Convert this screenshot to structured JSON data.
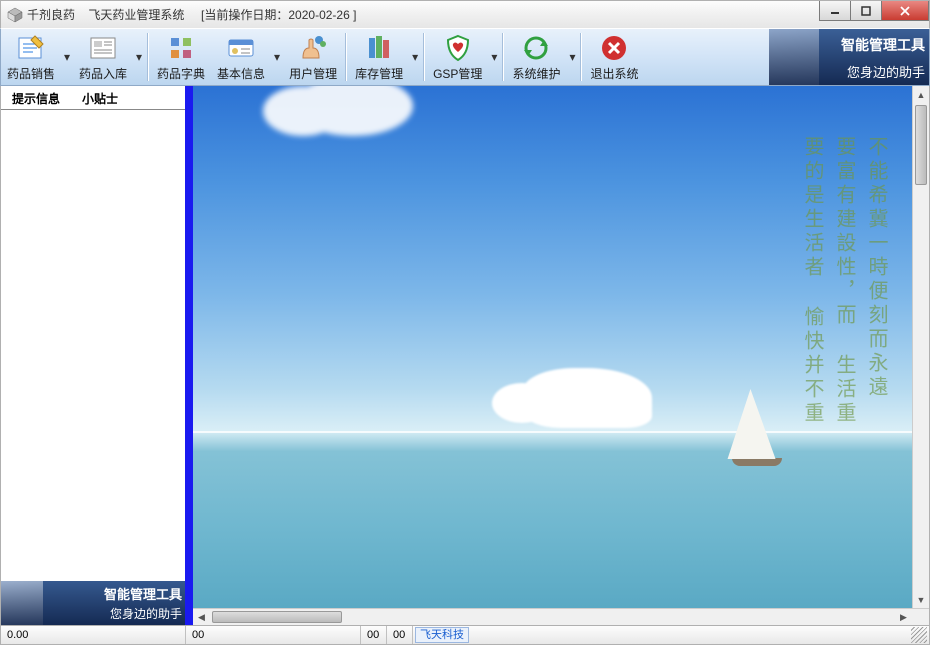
{
  "titlebar": {
    "app_name": "千剂良药",
    "system_name": "飞天药业管理系统",
    "date_label": "[当前操作日期：2020-02-26 ]"
  },
  "toolbar": {
    "items": [
      {
        "label": "药品销售",
        "icon": "edit-note-icon",
        "dropdown": true
      },
      {
        "label": "药品入库",
        "icon": "newspaper-icon",
        "dropdown": true
      },
      {
        "label": "药品字典",
        "icon": "tiles-icon",
        "dropdown": false
      },
      {
        "label": "基本信息",
        "icon": "card-icon",
        "dropdown": true
      },
      {
        "label": "用户管理",
        "icon": "hand-people-icon",
        "dropdown": false
      },
      {
        "label": "库存管理",
        "icon": "books-icon",
        "dropdown": true
      },
      {
        "label": "GSP管理",
        "icon": "shield-heart-icon",
        "dropdown": true
      },
      {
        "label": "系统维护",
        "icon": "refresh-icon",
        "dropdown": true
      },
      {
        "label": "退出系统",
        "icon": "close-round-icon",
        "dropdown": false
      }
    ],
    "brand": {
      "line1": "智能管理工具",
      "line2": "您身边的助手"
    }
  },
  "leftPanel": {
    "tabs": [
      {
        "label": "提示信息",
        "active": true
      },
      {
        "label": "小贴士",
        "active": false
      }
    ],
    "badge": {
      "line1": "智能管理工具",
      "line2": "您身边的助手"
    }
  },
  "poem": {
    "text": "不能希冀一時便刻而永遠\n要富有建設性，而\n生活重要的是生活者\n愉快并不重"
  },
  "statusbar": {
    "cell1": "0.00",
    "cell2": "00",
    "cell3": "00",
    "cell4": "00",
    "link": "飞天科技"
  },
  "icon_colors": {
    "edit-note-icon": "#2a7de1",
    "newspaper-icon": "#888888",
    "tiles-icon": "#2a7de1",
    "card-icon": "#e0a030",
    "hand-people-icon": "#d07030",
    "books-icon": "#2a90c0",
    "shield-heart-icon": "#30a040",
    "refresh-icon": "#30a040",
    "close-round-icon": "#d03030"
  }
}
